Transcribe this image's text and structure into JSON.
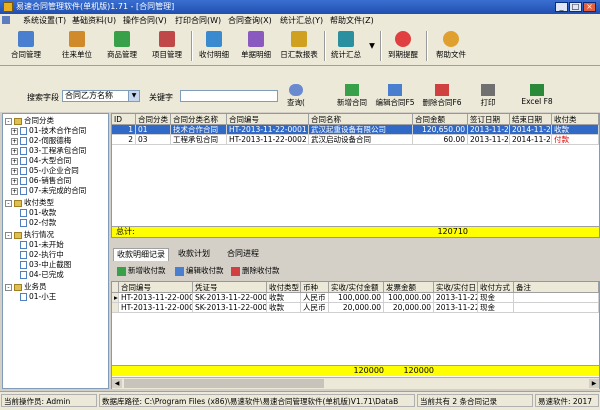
{
  "window": {
    "title": "易速合同管理软件(单机版)1.71 - [合同管理]",
    "min_label": "_",
    "max_label": "□",
    "close_label": "×"
  },
  "menu": [
    "系统设置(T)",
    "基础资料(U)",
    "操作合同(V)",
    "打印合同(W)",
    "合同查询(X)",
    "统计汇总(Y)",
    "帮助文件(Z)"
  ],
  "toolbar": {
    "buttons": [
      {
        "label": "合同管理",
        "icon": "contract-icon",
        "color": "#4a7fd0"
      },
      {
        "label": "往来单位",
        "icon": "company-icon",
        "color": "#d08a2a"
      },
      {
        "label": "商品管理",
        "icon": "goods-icon",
        "color": "#38a048"
      },
      {
        "label": "项目管理",
        "icon": "project-icon",
        "color": "#c04848"
      },
      {
        "label": "收付明细",
        "icon": "payment-icon",
        "color": "#3a8ad0"
      },
      {
        "label": "单据明细",
        "icon": "document-icon",
        "color": "#8a5ac0"
      },
      {
        "label": "日汇款报表",
        "icon": "report-icon",
        "color": "#d0a020"
      },
      {
        "label": "统计汇总",
        "icon": "stats-icon",
        "color": "#2a90a0"
      },
      {
        "label": "到期提醒",
        "icon": "alarm-clock-icon",
        "color": "#e04040"
      },
      {
        "label": "帮助文件",
        "icon": "help-icon",
        "color": "#e0a030"
      }
    ]
  },
  "search": {
    "field_label": "搜索字段",
    "field_value": "合同乙方名称",
    "keyword_label": "关键字",
    "keyword_value": "",
    "query_btn": "查询(",
    "buttons": [
      "新增合同",
      "编辑合同F5",
      "删除合同F6",
      "打印",
      "Excel F8"
    ]
  },
  "tree": [
    {
      "label": "合同分类",
      "level": 0,
      "type": "folder",
      "exp": "-"
    },
    {
      "label": "01-技术合作合同",
      "level": 1,
      "type": "doc",
      "exp": "+"
    },
    {
      "label": "02-伺服德梅",
      "level": 1,
      "type": "doc",
      "exp": "+"
    },
    {
      "label": "03-工程承包合同",
      "level": 1,
      "type": "doc",
      "exp": "+"
    },
    {
      "label": "04-大型合同",
      "level": 1,
      "type": "doc",
      "exp": "+"
    },
    {
      "label": "05-小企业合同",
      "level": 1,
      "type": "doc",
      "exp": "+"
    },
    {
      "label": "06-销售合同",
      "level": 1,
      "type": "doc",
      "exp": "+"
    },
    {
      "label": "07-未完成的合同",
      "level": 1,
      "type": "doc",
      "exp": "+"
    },
    {
      "label": "收付类型",
      "level": 0,
      "type": "folder",
      "exp": "-"
    },
    {
      "label": "01-收款",
      "level": 1,
      "type": "doc",
      "exp": ""
    },
    {
      "label": "02-付款",
      "level": 1,
      "type": "doc",
      "exp": ""
    },
    {
      "label": "执行情况",
      "level": 0,
      "type": "folder",
      "exp": "-"
    },
    {
      "label": "01-未开始",
      "level": 1,
      "type": "doc",
      "exp": ""
    },
    {
      "label": "02-执行中",
      "level": 1,
      "type": "doc",
      "exp": ""
    },
    {
      "label": "03-中止截图",
      "level": 1,
      "type": "doc",
      "exp": ""
    },
    {
      "label": "04-已完成",
      "level": 1,
      "type": "doc",
      "exp": ""
    },
    {
      "label": "业务员",
      "level": 0,
      "type": "folder",
      "exp": "-"
    },
    {
      "label": "01-小王",
      "level": 1,
      "type": "doc",
      "exp": ""
    }
  ],
  "grid1": {
    "headers": [
      "ID",
      "合同分类",
      "合同分类名称",
      "合同编号",
      "合同名称",
      "合同金额",
      "签订日期",
      "结束日期",
      "收付类"
    ],
    "rows": [
      [
        "1",
        "01",
        "技术合作合同",
        "HT-2013-11-22-0001",
        "武汉起重设备有限公司",
        "120,650.00",
        "2013-11-22",
        "2014-11-22",
        "收款"
      ],
      [
        "2",
        "03",
        "工程承包合同",
        "HT-2013-11-22-0002",
        "武汉启动设备合同",
        "60.00",
        "2013-11-22",
        "2014-11-22",
        "付款"
      ]
    ],
    "sum_label": "总计:",
    "sum_value": "120710"
  },
  "tabs": [
    "收款明细记录",
    "收款计划",
    "合同进程"
  ],
  "subtool": [
    "新增收付款",
    "编辑收付款",
    "删除收付款"
  ],
  "grid2": {
    "headers": [
      "合同编号",
      "凭证号",
      "收付类型",
      "币种",
      "实收/实付金额",
      "发票金额",
      "实收/实付日",
      "收付方式",
      "备注"
    ],
    "rows": [
      [
        "HT-2013-11-22-0001",
        "SK-2013-11-22-0001",
        "收款",
        "人民币",
        "100,000.00",
        "100,000.00",
        "2013-11-22",
        "现金",
        ""
      ],
      [
        "HT-2013-11-22-0002",
        "SK-2013-11-22-0002",
        "收款",
        "人民币",
        "20,000.00",
        "20,000.00",
        "2013-11-22",
        "现金",
        ""
      ]
    ],
    "sum1": "120000",
    "sum2": "120000"
  },
  "status": {
    "operator": "当前操作员: Admin",
    "dbpath": "数据库路径: C:\\Program Files (x86)\\易速软件\\易速合同管理软件(单机版)V1.71\\DataB",
    "count": "当前共有 2 条合同记录",
    "site": "易速软件: 2017"
  },
  "colors": {
    "selection": "#3169c6",
    "sum": "#ffff00",
    "title": "#1f4fb0"
  }
}
